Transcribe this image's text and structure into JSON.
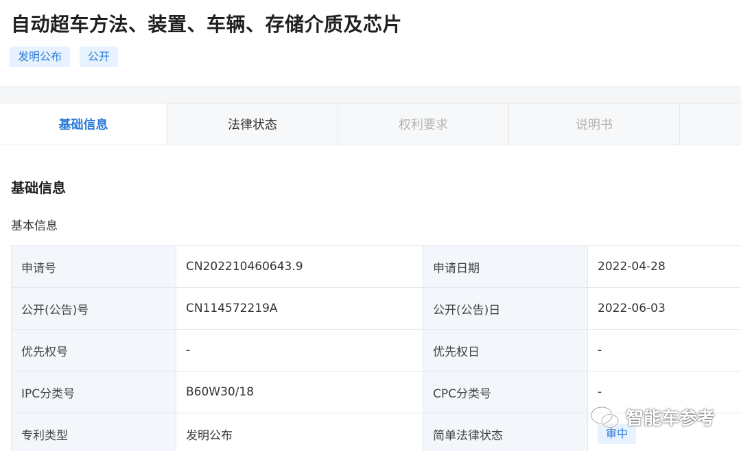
{
  "patent": {
    "title": "自动超车方法、装置、车辆、存储介质及芯片",
    "tags": [
      "发明公布",
      "公开"
    ]
  },
  "tabs": [
    {
      "label": "基础信息",
      "state": "active"
    },
    {
      "label": "法律状态",
      "state": "enabled"
    },
    {
      "label": "权利要求",
      "state": "disabled"
    },
    {
      "label": "说明书",
      "state": "disabled"
    }
  ],
  "section_title": "基础信息",
  "sub_title": "基本信息",
  "info_rows": [
    {
      "label1": "申请号",
      "value1": "CN202210460643.9",
      "label2": "申请日期",
      "value2": "2022-04-28"
    },
    {
      "label1": "公开(公告)号",
      "value1": "CN114572219A",
      "label2": "公开(公告)日",
      "value2": "2022-06-03"
    },
    {
      "label1": "优先权号",
      "value1": "-",
      "label2": "优先权日",
      "value2": "-"
    },
    {
      "label1": "IPC分类号",
      "value1": "B60W30/18",
      "label2": "CPC分类号",
      "value2": "-"
    },
    {
      "label1": "专利类型",
      "value1": "发明公布",
      "label2": "简单法律状态",
      "value2": "审中"
    }
  ],
  "watermark": {
    "text": "智能车参考",
    "icon": "wechat-icon"
  },
  "colors": {
    "accent": "#2a7ad8",
    "tag_bg": "#e6f2fd",
    "label_bg": "#f3f6fa",
    "tabbar_bg": "#f7f8fa",
    "disabled_tab": "#b3b3b3"
  }
}
